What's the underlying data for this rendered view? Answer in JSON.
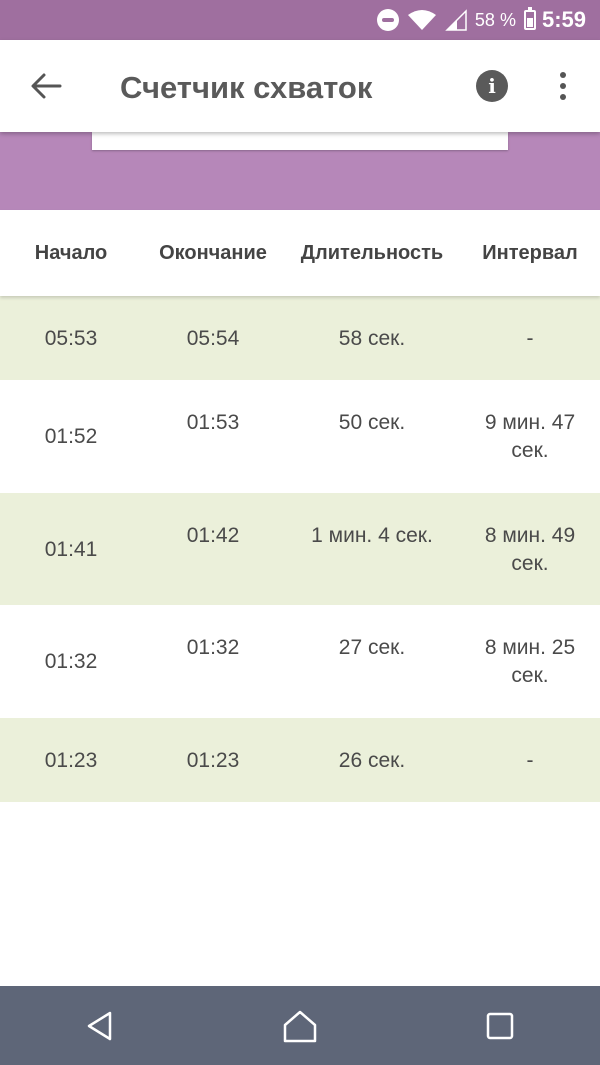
{
  "status_bar": {
    "battery_percent": "58 %",
    "time": "5:59"
  },
  "app_bar": {
    "title": "Счетчик схваток",
    "info_label": "i"
  },
  "table": {
    "headers": [
      "Начало",
      "Окончание",
      "Длительность",
      "Интервал"
    ],
    "rows": [
      {
        "start": "05:53",
        "end": "05:54",
        "duration": "58 сек.",
        "interval": "-"
      },
      {
        "start": "01:52",
        "end": "01:53",
        "duration": "50 сек.",
        "interval": "9 мин. 47 сек."
      },
      {
        "start": "01:41",
        "end": "01:42",
        "duration": "1 мин. 4 сек.",
        "interval": "8 мин. 49 сек."
      },
      {
        "start": "01:32",
        "end": "01:32",
        "duration": "27 сек.",
        "interval": "8 мин. 25 сек."
      },
      {
        "start": "01:23",
        "end": "01:23",
        "duration": "26 сек.",
        "interval": "-"
      }
    ]
  },
  "colors": {
    "status_bar": "#9f6f9f",
    "header_band": "#b687b9",
    "row_alt": "#ebf0da",
    "nav_bar": "#5e6678"
  }
}
